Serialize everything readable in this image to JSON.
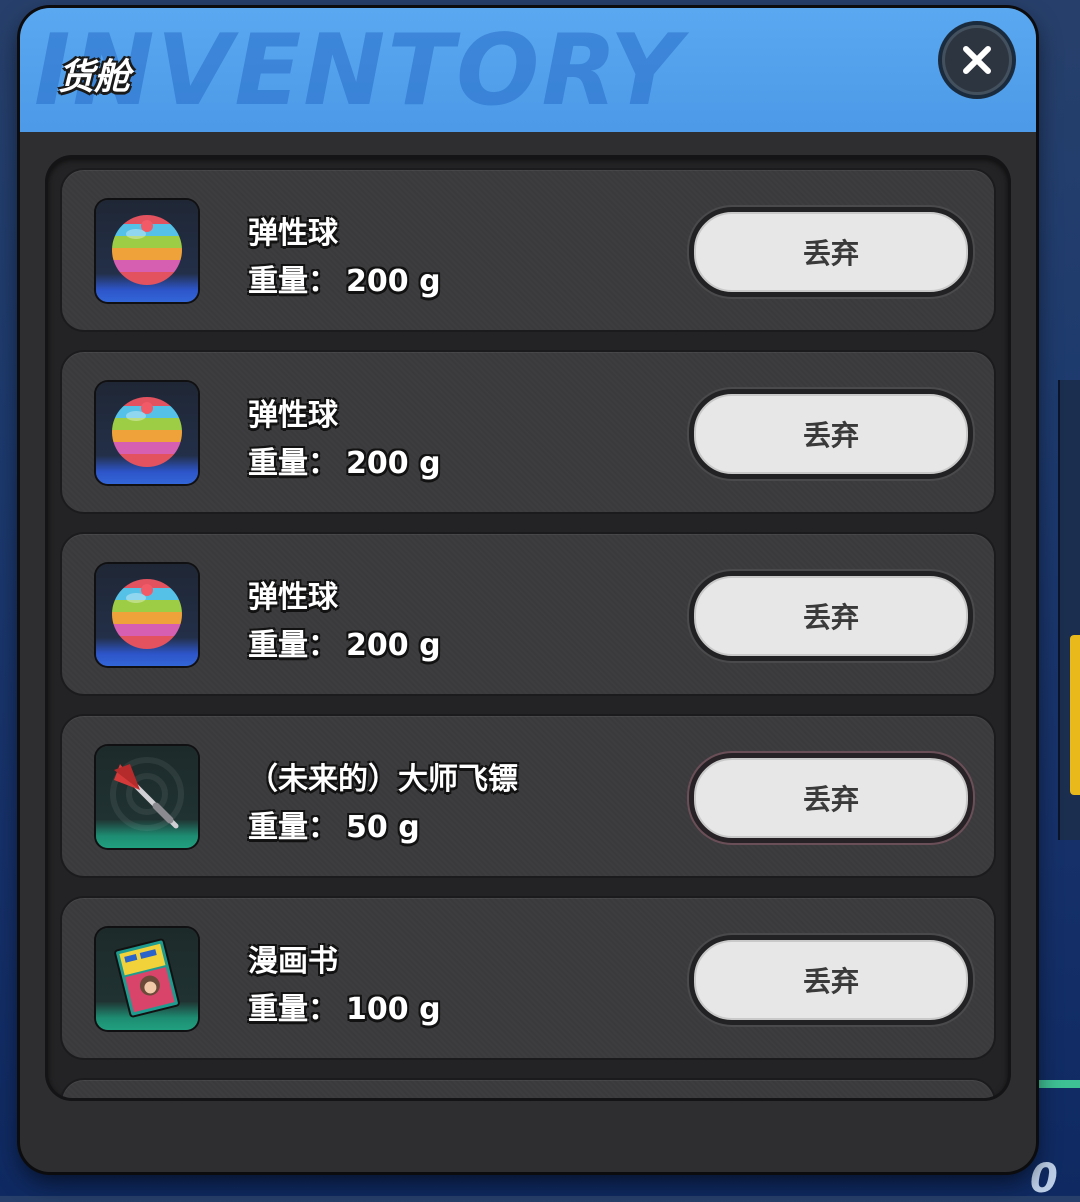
{
  "window": {
    "title": "货舱",
    "watermark": "INVENTORY",
    "close_icon": "close-icon"
  },
  "items": [
    {
      "name": "弹性球",
      "weight_label": "重量：",
      "weight_value": "200 g",
      "discard_label": "丢弃",
      "icon": "rainbow-ball-icon"
    },
    {
      "name": "弹性球",
      "weight_label": "重量：",
      "weight_value": "200 g",
      "discard_label": "丢弃",
      "icon": "rainbow-ball-icon"
    },
    {
      "name": "弹性球",
      "weight_label": "重量：",
      "weight_value": "200 g",
      "discard_label": "丢弃",
      "icon": "rainbow-ball-icon"
    },
    {
      "name": "（未来的）大师飞镖",
      "weight_label": "重量：",
      "weight_value": "50 g",
      "discard_label": "丢弃",
      "icon": "dart-icon"
    },
    {
      "name": "漫画书",
      "weight_label": "重量：",
      "weight_value": "100 g",
      "discard_label": "丢弃",
      "icon": "comic-book-icon"
    }
  ],
  "colors": {
    "header": "#4c9ae8",
    "panel": "#2e2e30",
    "button": "#e7e7e7",
    "rare_blue": "#3266d8",
    "uncommon_green": "#20a07f"
  }
}
